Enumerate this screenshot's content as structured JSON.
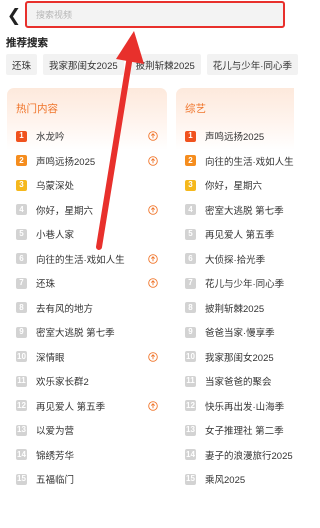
{
  "search": {
    "placeholder": "搜索视频",
    "value": ""
  },
  "recommend": {
    "title": "推荐搜索",
    "chips": [
      "还珠",
      "我家那闺女2025",
      "披荆斩棘2025",
      "花儿与少年·同心季"
    ]
  },
  "hot": {
    "title": "热门内容",
    "items": [
      {
        "rank": "1",
        "label": "水龙吟",
        "trend": true
      },
      {
        "rank": "2",
        "label": "声鸣远扬2025",
        "trend": true
      },
      {
        "rank": "3",
        "label": "乌蒙深处",
        "trend": false
      },
      {
        "rank": "4",
        "label": "你好，星期六",
        "trend": true
      },
      {
        "rank": "5",
        "label": "小巷人家",
        "trend": false
      },
      {
        "rank": "6",
        "label": "向往的生活·戏如人生",
        "trend": true
      },
      {
        "rank": "7",
        "label": "还珠",
        "trend": true
      },
      {
        "rank": "8",
        "label": "去有风的地方",
        "trend": false
      },
      {
        "rank": "9",
        "label": "密室大逃脱 第七季",
        "trend": false
      },
      {
        "rank": "10",
        "label": "深情眼",
        "trend": true
      },
      {
        "rank": "11",
        "label": "欢乐家长群2",
        "trend": false
      },
      {
        "rank": "12",
        "label": "再见爱人 第五季",
        "trend": true
      },
      {
        "rank": "13",
        "label": "以爱为营",
        "trend": false
      },
      {
        "rank": "14",
        "label": "锦绣芳华",
        "trend": false
      },
      {
        "rank": "15",
        "label": "五福临门",
        "trend": false
      }
    ]
  },
  "variety": {
    "title": "综艺",
    "items": [
      {
        "rank": "1",
        "label": "声鸣远扬2025"
      },
      {
        "rank": "2",
        "label": "向往的生活·戏如人生"
      },
      {
        "rank": "3",
        "label": "你好，星期六"
      },
      {
        "rank": "4",
        "label": "密室大逃脱 第七季"
      },
      {
        "rank": "5",
        "label": "再见爱人 第五季"
      },
      {
        "rank": "6",
        "label": "大侦探·拾光季"
      },
      {
        "rank": "7",
        "label": "花儿与少年·同心季"
      },
      {
        "rank": "8",
        "label": "披荆斩棘2025"
      },
      {
        "rank": "9",
        "label": "爸爸当家·慢享季"
      },
      {
        "rank": "10",
        "label": "我家那闺女2025"
      },
      {
        "rank": "11",
        "label": "当家爸爸的聚会"
      },
      {
        "rank": "12",
        "label": "快乐再出发·山海季"
      },
      {
        "rank": "13",
        "label": "女子推理社 第二季"
      },
      {
        "rank": "14",
        "label": "妻子的浪漫旅行2025"
      },
      {
        "rank": "15",
        "label": "乘风2025"
      }
    ]
  },
  "colors": {
    "accent": "#f0752b",
    "annotation": "#e8302c",
    "rank1": "#f0521e",
    "rank2": "#f58d1e",
    "rank3": "#f5b81c",
    "rank_other": "#d3d3d3"
  }
}
